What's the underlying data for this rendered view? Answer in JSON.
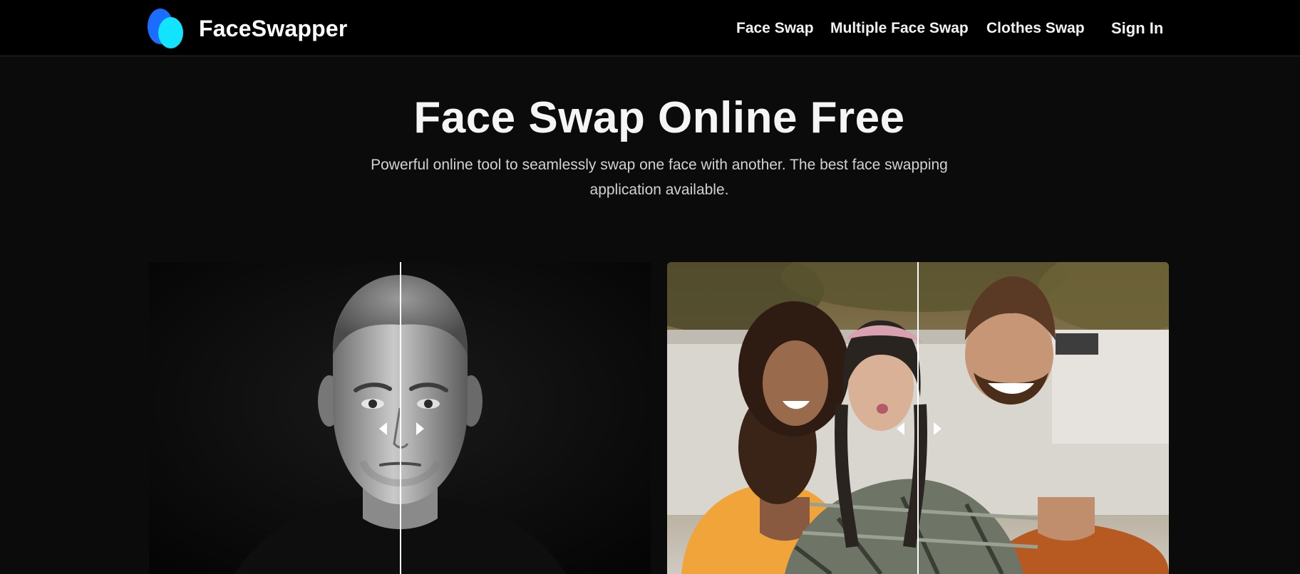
{
  "header": {
    "brand_name": "FaceSwapper",
    "logo_icon": "faceswapper-logo-icon",
    "nav": [
      {
        "label": "Face Swap"
      },
      {
        "label": "Multiple Face Swap"
      },
      {
        "label": "Clothes Swap"
      },
      {
        "label": "Sign In"
      }
    ]
  },
  "hero": {
    "title": "Face Swap Online Free",
    "subtitle": "Powerful online tool to seamlessly swap one face with another. The best face swapping application available."
  },
  "comparisons": [
    {
      "name": "single-face-comparison",
      "slider_position_percent": 50,
      "handle_icons": [
        "arrow-left-icon",
        "arrow-right-icon"
      ]
    },
    {
      "name": "group-face-comparison",
      "slider_position_percent": 50,
      "handle_icons": [
        "arrow-left-icon",
        "arrow-right-icon"
      ]
    }
  ],
  "colors": {
    "page_background": "#0b0b0b",
    "header_background": "#000000",
    "logo_blue": "#1b6dff",
    "logo_cyan": "#12e3ff",
    "divider": "#ffffff"
  }
}
